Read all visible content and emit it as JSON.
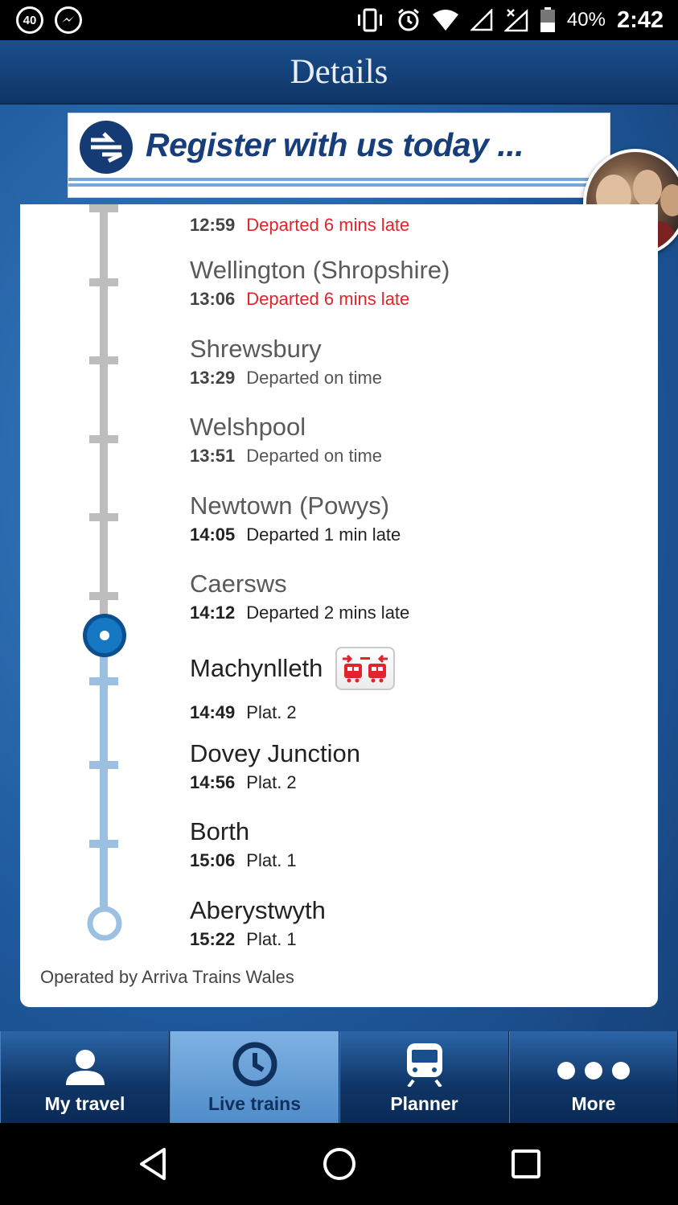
{
  "status_bar": {
    "notification_count": "40",
    "battery": "40%",
    "time": "2:42",
    "icons": [
      "messenger-icon",
      "vibrate-icon",
      "alarm-icon",
      "wifi-icon",
      "signal-icon",
      "signal-no-data-icon",
      "battery-icon"
    ]
  },
  "header": {
    "title": "Details"
  },
  "banner": {
    "text": "Register with us today ..."
  },
  "stops": [
    {
      "name": "",
      "time": "12:59",
      "status": "Departed 6 mins late",
      "late": true
    },
    {
      "name": "Wellington (Shropshire)",
      "time": "13:06",
      "status": "Departed 6 mins late",
      "late": true
    },
    {
      "name": "Shrewsbury",
      "time": "13:29",
      "status": "Departed on time",
      "late": false
    },
    {
      "name": "Welshpool",
      "time": "13:51",
      "status": "Departed on time",
      "late": false
    },
    {
      "name": "Newtown (Powys)",
      "time": "14:05",
      "status": "Departed 1 min late",
      "late": false
    },
    {
      "name": "Caersws",
      "time": "14:12",
      "status": "Departed 2 mins late",
      "late": false
    },
    {
      "name": "Machynlleth",
      "time": "14:49",
      "status": "Plat. 2",
      "late": false,
      "change_icon": "train-change-icon"
    },
    {
      "name": "Dovey Junction",
      "time": "14:56",
      "status": "Plat. 2",
      "late": false
    },
    {
      "name": "Borth",
      "time": "15:06",
      "status": "Plat. 1",
      "late": false
    },
    {
      "name": "Aberystwyth",
      "time": "15:22",
      "status": "Plat. 1",
      "late": false
    }
  ],
  "operator": "Operated by Arriva Trains Wales",
  "tabs": [
    {
      "label": "My travel",
      "icon": "person-icon",
      "active": false
    },
    {
      "label": "Live trains",
      "icon": "clock-icon",
      "active": true
    },
    {
      "label": "Planner",
      "icon": "train-icon",
      "active": false
    },
    {
      "label": "More",
      "icon": "more-dots-icon",
      "active": false
    }
  ],
  "colors": {
    "late": "#e0242b",
    "track_past": "#bdbdbd",
    "track_future": "#9cc0e2",
    "header": "#1a4f8e"
  }
}
